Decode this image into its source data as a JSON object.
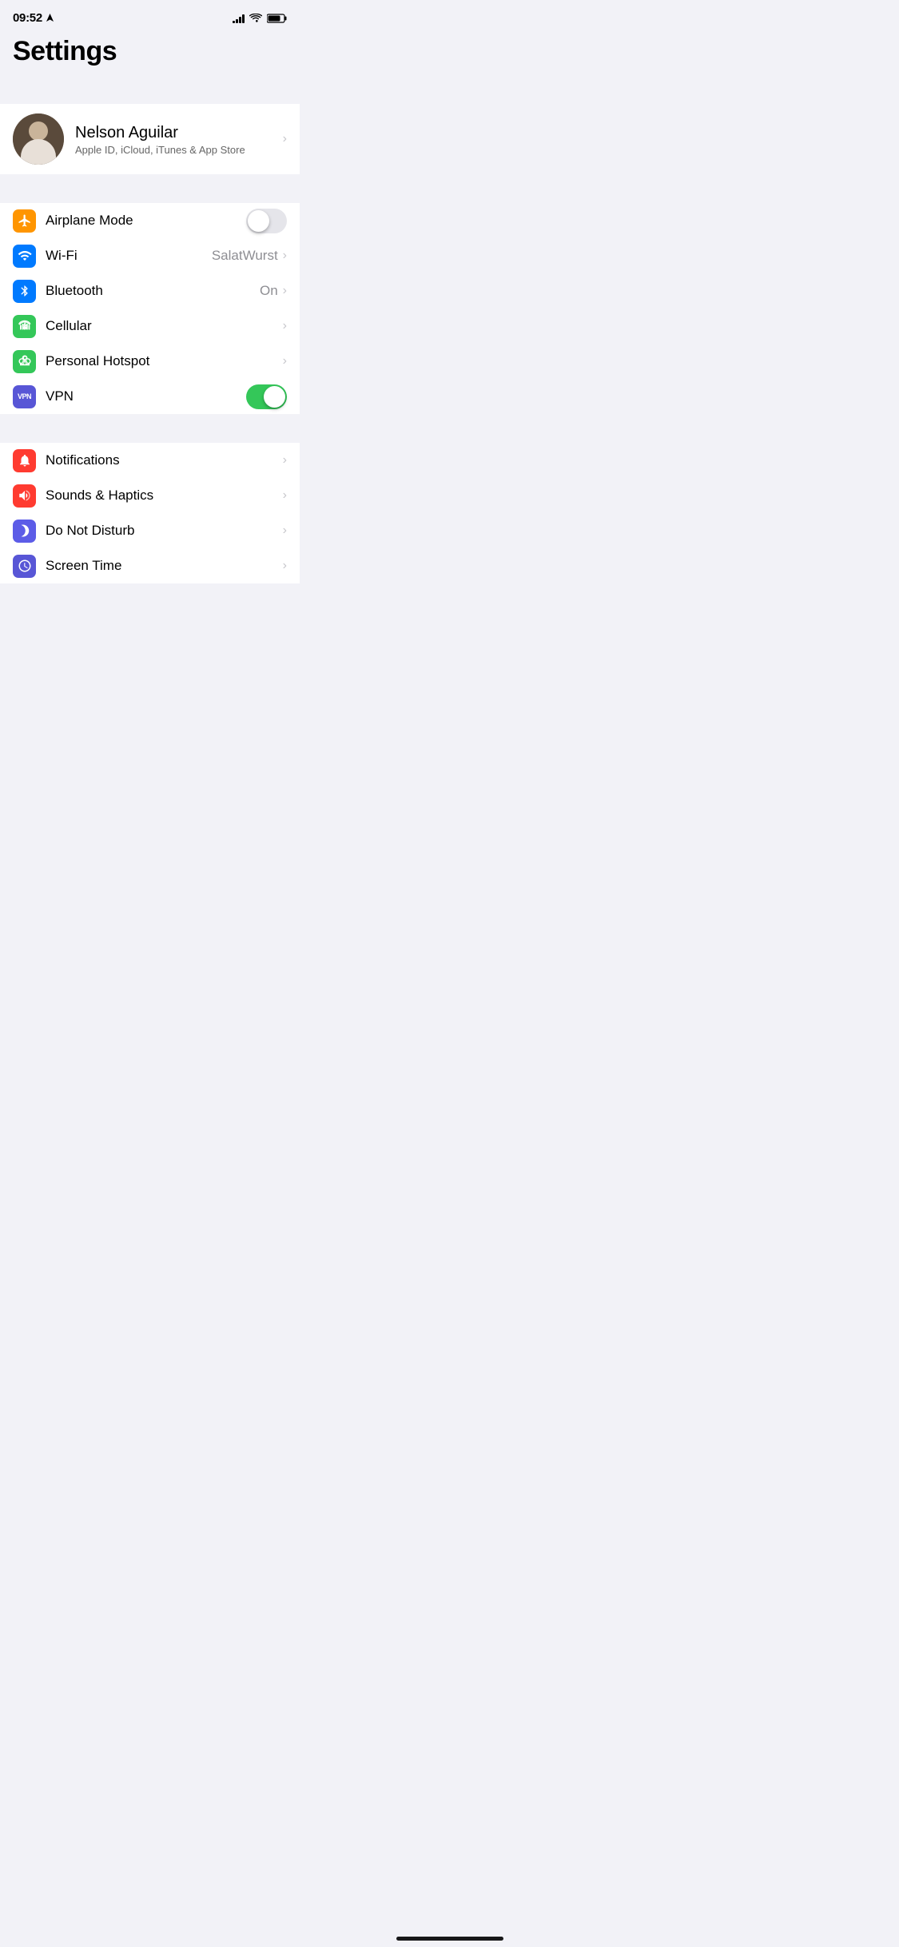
{
  "statusBar": {
    "time": "09:52",
    "hasLocation": true
  },
  "header": {
    "title": "Settings"
  },
  "profile": {
    "name": "Nelson Aguilar",
    "subtitle": "Apple ID, iCloud, iTunes & App Store"
  },
  "connectivity": [
    {
      "id": "airplane-mode",
      "label": "Airplane Mode",
      "iconColor": "icon-orange",
      "iconSymbol": "✈",
      "type": "toggle",
      "toggleOn": false
    },
    {
      "id": "wifi",
      "label": "Wi-Fi",
      "iconColor": "icon-blue",
      "iconSymbol": "wifi",
      "type": "value-arrow",
      "value": "SalatWurst"
    },
    {
      "id": "bluetooth",
      "label": "Bluetooth",
      "iconColor": "icon-blue-mid",
      "iconSymbol": "bluetooth",
      "type": "value-arrow",
      "value": "On"
    },
    {
      "id": "cellular",
      "label": "Cellular",
      "iconColor": "icon-green-cellular",
      "iconSymbol": "cellular",
      "type": "arrow"
    },
    {
      "id": "personal-hotspot",
      "label": "Personal Hotspot",
      "iconColor": "icon-green",
      "iconSymbol": "hotspot",
      "type": "arrow"
    },
    {
      "id": "vpn",
      "label": "VPN",
      "iconColor": "icon-purple-vpn",
      "iconSymbol": "VPN",
      "type": "toggle",
      "toggleOn": true
    }
  ],
  "notifications": [
    {
      "id": "notifications",
      "label": "Notifications",
      "iconColor": "icon-red",
      "iconSymbol": "notif",
      "type": "arrow"
    },
    {
      "id": "sounds-haptics",
      "label": "Sounds & Haptics",
      "iconColor": "icon-red-sounds",
      "iconSymbol": "sound",
      "type": "arrow"
    },
    {
      "id": "do-not-disturb",
      "label": "Do Not Disturb",
      "iconColor": "icon-indigo",
      "iconSymbol": "moon",
      "type": "arrow"
    },
    {
      "id": "screen-time",
      "label": "Screen Time",
      "iconColor": "icon-purple",
      "iconSymbol": "hourglass",
      "type": "arrow"
    }
  ]
}
